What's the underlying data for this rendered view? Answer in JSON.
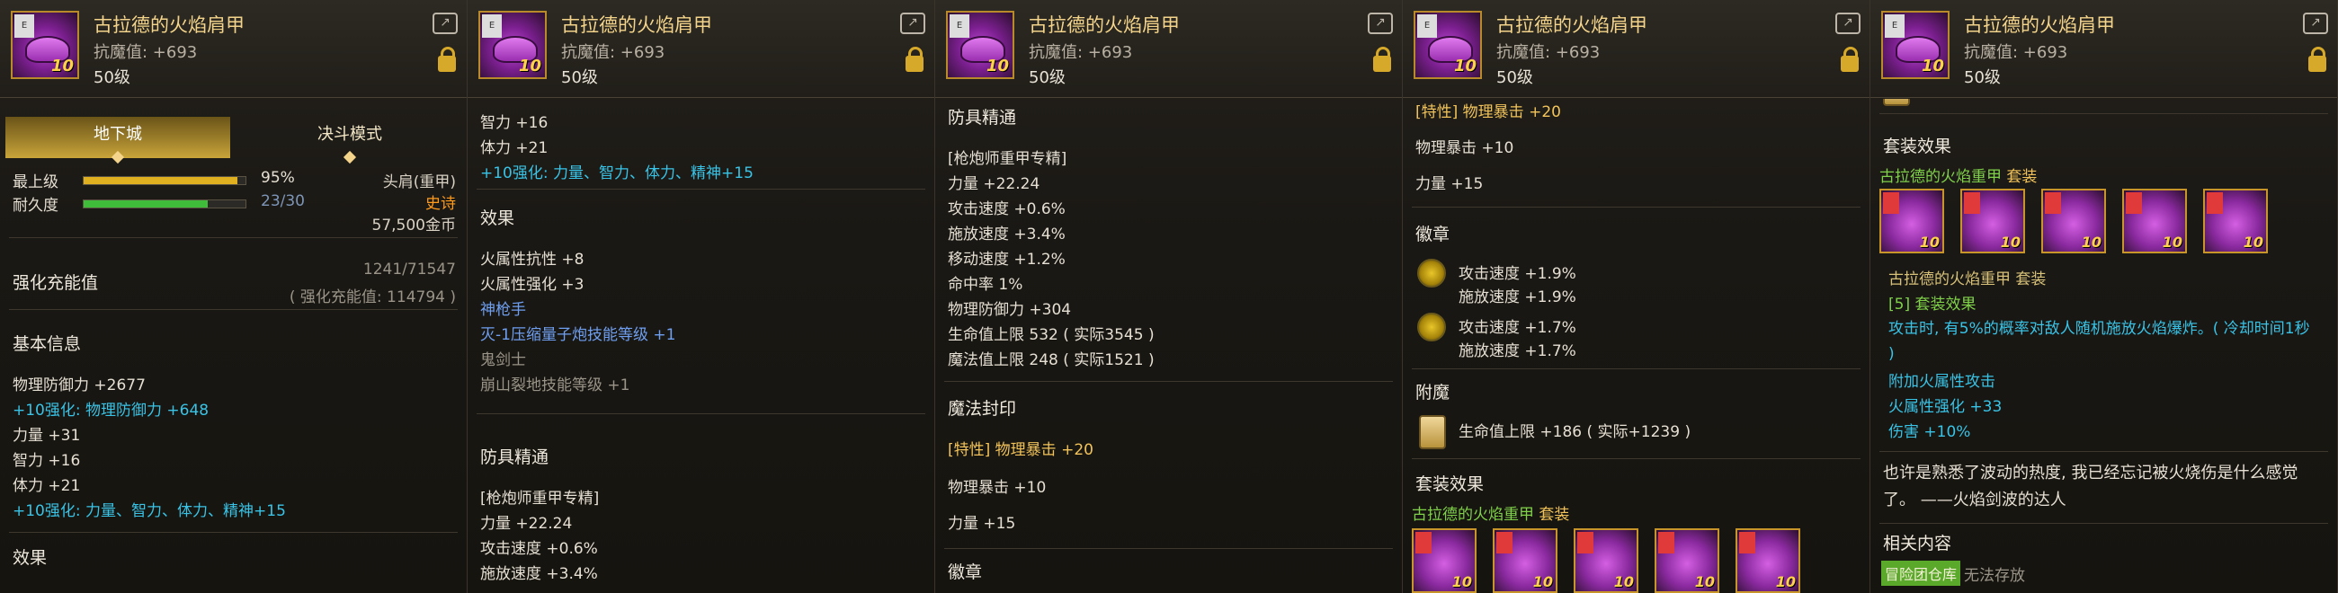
{
  "item": {
    "name": "古拉德的火焰肩甲",
    "magic_def": "抗魔值: +693",
    "level": "50级",
    "icon_level": "10"
  },
  "panel1": {
    "tabs": [
      "地下城",
      "决斗模式"
    ],
    "upper_label": "最上级",
    "upper_value": "95%",
    "upper_progress": 0.95,
    "durability_label": "耐久度",
    "durability_value": "23/30",
    "durability_progress": 0.7667,
    "slot": "头肩(重甲)",
    "rarity": "史诗",
    "price": "57,500金币",
    "enhance_label": "强化充能值",
    "enhance_value": "1241/71547",
    "enhance_sub": "( 强化充能值: 114794 )",
    "basic_header": "基本信息",
    "lines": [
      {
        "text": "物理防御力 +2677",
        "cls": ""
      },
      {
        "text": "+10强化: 物理防御力 +648",
        "cls": "cyan"
      },
      {
        "text": "力量 +31",
        "cls": ""
      },
      {
        "text": "智力 +16",
        "cls": ""
      },
      {
        "text": "体力 +21",
        "cls": ""
      },
      {
        "text": "+10强化: 力量、智力、体力、精神+15",
        "cls": "cyan"
      }
    ],
    "effect_header": "效果"
  },
  "panel2": {
    "lines_top": [
      {
        "text": "智力 +16",
        "cls": ""
      },
      {
        "text": "体力 +21",
        "cls": ""
      },
      {
        "text": "+10强化: 力量、智力、体力、精神+15",
        "cls": "cyan"
      }
    ],
    "effect_header": "效果",
    "effect_lines": [
      {
        "text": "火属性抗性 +8",
        "cls": ""
      },
      {
        "text": "火属性强化 +3",
        "cls": ""
      },
      {
        "text": "神枪手",
        "cls": "blue"
      },
      {
        "text": "灭-1压缩量子炮技能等级 +1",
        "cls": "blue"
      },
      {
        "text": "鬼剑士",
        "cls": "grey"
      },
      {
        "text": "崩山裂地技能等级 +1",
        "cls": "grey"
      }
    ],
    "mastery_header": "防具精通",
    "mastery_lines": [
      {
        "text": "[枪炮师重甲专精]",
        "cls": ""
      },
      {
        "text": "力量 +22.24",
        "cls": ""
      },
      {
        "text": "攻击速度 +0.6%",
        "cls": ""
      },
      {
        "text": "施放速度 +3.4%",
        "cls": ""
      }
    ]
  },
  "panel3": {
    "mastery_header": "防具精通",
    "mastery_lines": [
      {
        "text": "[枪炮师重甲专精]",
        "cls": ""
      },
      {
        "text": "力量 +22.24",
        "cls": ""
      },
      {
        "text": "攻击速度 +0.6%",
        "cls": ""
      },
      {
        "text": "施放速度 +3.4%",
        "cls": ""
      },
      {
        "text": "移动速度 +1.2%",
        "cls": ""
      },
      {
        "text": "命中率 1%",
        "cls": ""
      },
      {
        "text": "物理防御力 +304",
        "cls": ""
      },
      {
        "text": "生命值上限 532 ( 实际3545 )",
        "cls": ""
      },
      {
        "text": "魔法值上限 248 ( 实际1521 )",
        "cls": ""
      }
    ],
    "seal_header": "魔法封印",
    "seal_trait": "[特性] 物理暴击 +20",
    "seal_lines": [
      "物理暴击 +10",
      "力量 +15"
    ],
    "badge_header": "徽章"
  },
  "panel4": {
    "trait": "[特性] 物理暴击 +20",
    "lines": [
      "物理暴击 +10",
      "力量 +15"
    ],
    "badge_header": "徽章",
    "badges": [
      {
        "a": "攻击速度 +1.9%",
        "b": "施放速度 +1.9%"
      },
      {
        "a": "攻击速度 +1.7%",
        "b": "施放速度 +1.7%"
      }
    ],
    "enchant_header": "附魔",
    "enchant_text": "生命值上限 +186 ( 实际+1239 )",
    "set_header": "套装效果",
    "set_name": "古拉德的火焰重甲",
    "set_suffix": "套装"
  },
  "panel5": {
    "set_header": "套装效果",
    "set_name": "古拉德的火焰重甲",
    "set_suffix": "套装",
    "set_title2": "古拉德的火焰重甲  套装",
    "set_count": "[5] 套装效果",
    "set_desc": "攻击时, 有5%的概率对敌人随机施放火焰爆炸。( 冷却时间1秒 )",
    "set_bonus": [
      "附加火属性攻击",
      "火属性强化 +33",
      "伤害 +10%"
    ],
    "flavor": "也许是熟悉了波动的热度, 我已经忘记被火烧伤是什么感觉了。 ——火焰剑波的达人",
    "related_header": "相关内容",
    "related_badge": "冒险团仓库",
    "related_text": "无法存放"
  }
}
